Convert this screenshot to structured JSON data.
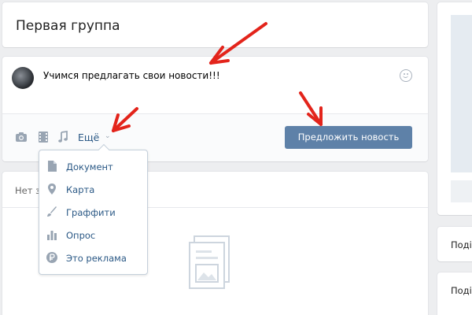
{
  "page": {
    "group_title": "Первая группа"
  },
  "composer": {
    "post_text": "Учимся предлагать свои новости!!!",
    "more_label": "Ещё",
    "suggest_button": "Предложить новость"
  },
  "attach_menu": {
    "items": [
      {
        "label": "Документ",
        "icon": "document-icon"
      },
      {
        "label": "Карта",
        "icon": "map-pin-icon"
      },
      {
        "label": "Граффити",
        "icon": "brush-icon"
      },
      {
        "label": "Опрос",
        "icon": "poll-icon"
      },
      {
        "label": "Это реклама",
        "icon": "ruble-icon"
      }
    ]
  },
  "posts": {
    "empty_text": "Нет з"
  },
  "right_column": {
    "label1": "Поді",
    "label2": "Поді"
  },
  "colors": {
    "accent": "#5e81a8",
    "link": "#2a5885",
    "annotation_arrow": "#e3241b"
  }
}
